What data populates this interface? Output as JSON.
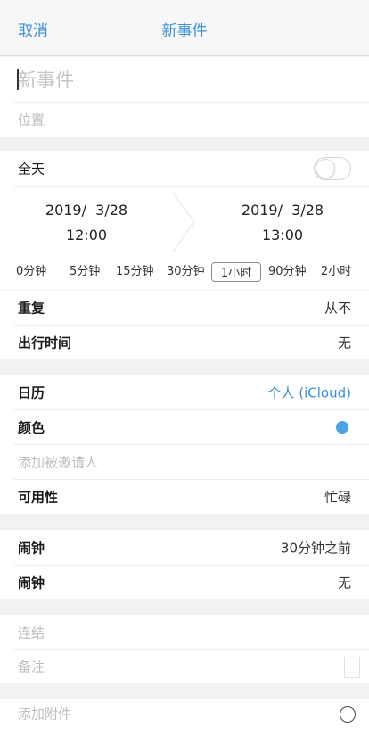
{
  "navbar": {
    "cancel_label": "取消",
    "title": "新事件"
  },
  "event": {
    "title_placeholder": "新事件",
    "location_placeholder": "位置"
  },
  "allday": {
    "label": "全天",
    "enabled": false
  },
  "start": {
    "date": "2019/  3/28",
    "time": "12:00"
  },
  "end": {
    "date": "2019/  3/28",
    "time": "13:00"
  },
  "durations": [
    "0分钟",
    "5分钟",
    "15分钟",
    "30分钟",
    "1小时",
    "90分钟",
    "2小时"
  ],
  "selected_duration": "1小时",
  "repeat": {
    "label": "重复",
    "value": "从不"
  },
  "travel": {
    "label": "出行时间",
    "value": "无"
  },
  "calendar": {
    "label": "日历",
    "value": "个人 (iCloud)"
  },
  "color": {
    "label": "颜色",
    "value_color": "#4aa3e6"
  },
  "invitees": {
    "placeholder": "添加被邀请人"
  },
  "availability": {
    "label": "可用性",
    "value": "忙碌"
  },
  "alarm1": {
    "label": "闹钟",
    "value": "30分钟之前"
  },
  "alarm2": {
    "label": "闹钟",
    "value": "无"
  },
  "url": {
    "placeholder": "连结"
  },
  "notes": {
    "placeholder": "备注"
  },
  "attachment": {
    "placeholder": "添加附件"
  },
  "colors": {
    "accent": "#3a8fd6",
    "dot": "#4aa3e6",
    "background": "#f2f2f2"
  }
}
